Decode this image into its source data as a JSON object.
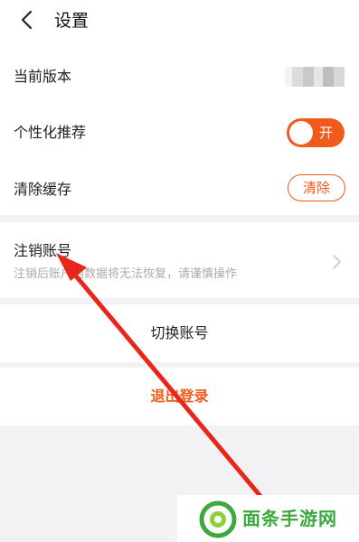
{
  "header": {
    "title": "设置",
    "back_icon": "chevron-left-icon"
  },
  "settings": {
    "version_label": "当前版本",
    "personalized_label": "个性化推荐",
    "personalized_toggle_text": "开",
    "personalized_enabled": true,
    "cache_label": "清除缓存",
    "cache_button": "清除"
  },
  "account": {
    "cancel_label": "注销账号",
    "cancel_desc": "注销后账户内数据将无法恢复，请谨慎操作",
    "switch_label": "切换账号",
    "logout_label": "退出登录"
  },
  "watermark": {
    "text": "面条手游网",
    "logo_icon": "noodle-logo-icon"
  },
  "colors": {
    "accent": "#f05a1a",
    "annotation_arrow": "#e8261c",
    "watermark": "#3ca93e"
  }
}
